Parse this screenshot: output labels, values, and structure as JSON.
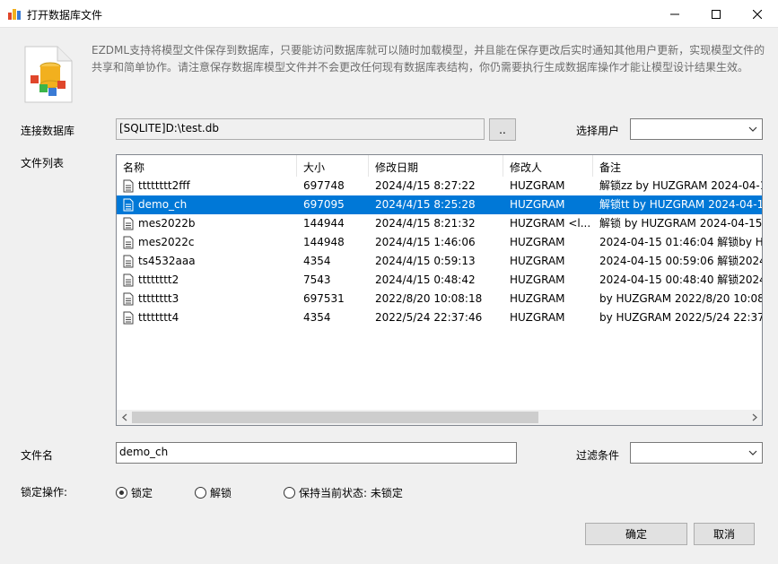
{
  "window": {
    "title": "打开数据库文件"
  },
  "intro_text": "EZDML支持将模型文件保存到数据库，只要能访问数据库就可以随时加载模型，并且能在保存更改后实时通知其他用户更新，实现模型文件的共享和简单协作。请注意保存数据库模型文件并不会更改任何现有数据库表结构，你仍需要执行生成数据库操作才能让模型设计结果生效。",
  "connection": {
    "label": "连接数据库",
    "value": "[SQLITE]D:\\test.db",
    "browse_label": ".."
  },
  "user": {
    "label": "选择用户",
    "value": ""
  },
  "file_list": {
    "label": "文件列表",
    "columns": [
      "名称",
      "大小",
      "修改日期",
      "修改人",
      "备注"
    ],
    "rows": [
      {
        "name": "tttttttt2fff",
        "size": "697748",
        "date": "2024/4/15 8:27:22",
        "modifier": "HUZGRAM",
        "note": "解锁zz by HUZGRAM 2024-04-1"
      },
      {
        "name": "demo_ch",
        "size": "697095",
        "date": "2024/4/15 8:25:28",
        "modifier": "HUZGRAM",
        "note": "解锁tt by HUZGRAM 2024-04-1",
        "selected": true
      },
      {
        "name": "mes2022b",
        "size": "144944",
        "date": "2024/4/15 8:21:32",
        "modifier": "HUZGRAM <l...",
        "note": "解锁 by HUZGRAM 2024-04-15"
      },
      {
        "name": "mes2022c",
        "size": "144948",
        "date": "2024/4/15 1:46:06",
        "modifier": "HUZGRAM",
        "note": "2024-04-15 01:46:04 解锁by HU"
      },
      {
        "name": "ts4532aaa",
        "size": "4354",
        "date": "2024/4/15 0:59:13",
        "modifier": "HUZGRAM",
        "note": "2024-04-15 00:59:06 解锁2024-"
      },
      {
        "name": "tttttttt2",
        "size": "7543",
        "date": "2024/4/15 0:48:42",
        "modifier": "HUZGRAM",
        "note": "2024-04-15 00:48:40 解锁2024-"
      },
      {
        "name": "tttttttt3",
        "size": "697531",
        "date": "2022/8/20 10:08:18",
        "modifier": "HUZGRAM",
        "note": "by HUZGRAM 2022/8/20 10:08:"
      },
      {
        "name": "tttttttt4",
        "size": "4354",
        "date": "2022/5/24 22:37:46",
        "modifier": "HUZGRAM",
        "note": "by HUZGRAM 2022/5/24 22:37:"
      }
    ]
  },
  "filename": {
    "label": "文件名",
    "value": "demo_ch"
  },
  "filter": {
    "label": "过滤条件",
    "value": ""
  },
  "lock": {
    "label": "锁定操作:",
    "options": [
      {
        "label": "锁定",
        "checked": true
      },
      {
        "label": "解锁",
        "checked": false
      },
      {
        "label": "保持当前状态: 未锁定",
        "checked": false
      }
    ]
  },
  "buttons": {
    "ok": "确定",
    "cancel": "取消"
  },
  "colors": {
    "selection": "#0078d7"
  }
}
